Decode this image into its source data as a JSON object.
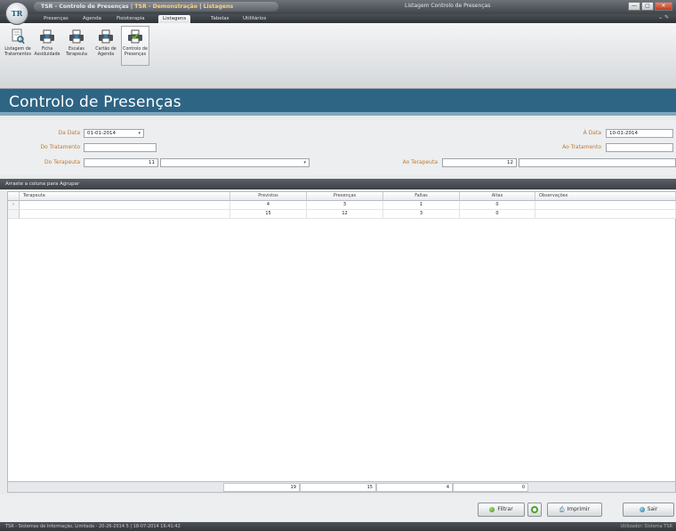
{
  "titlebar": {
    "path_app": "TSR - Controlo de Presenças",
    "sep1": " | ",
    "path_db": "TSR - Demonstração",
    "sep2": " | ",
    "path_view": "Listagens",
    "window_title": "Listagem Controlo de Presenças",
    "app_icon": "TR",
    "min_glyph": "—",
    "max_glyph": "▢",
    "close_glyph": "✕"
  },
  "menu": {
    "tabs": [
      "Presenças",
      "Agenda",
      "Fisioterapia",
      "Listagens",
      "Tabelas",
      "Utilitários"
    ],
    "active_index": 3,
    "right_glyphs": "⌄  ✎"
  },
  "ribbon": {
    "buttons": [
      {
        "label": "Listagem de Tratamentos",
        "icon": "document-search-icon"
      },
      {
        "label": "Ficha Assiduidade",
        "icon": "printer-icon"
      },
      {
        "label": "Escalas Terapeuta",
        "icon": "printer-icon"
      },
      {
        "label": "Cartão de Agenda",
        "icon": "printer-icon"
      },
      {
        "label": "Controlo de Presenças",
        "icon": "printer-check-icon"
      }
    ]
  },
  "page": {
    "title": "Controlo de Presenças"
  },
  "filters": {
    "da_data_label": "Da Data",
    "da_data_value": "01-01-2014",
    "a_data_label": "À Data",
    "a_data_value": "10-01-2014",
    "do_tratamento_label": "Do Tratamento",
    "do_tratamento_value": "",
    "ao_tratamento_label": "Ao Tratamento",
    "ao_tratamento_value": "",
    "do_terapeuta_label": "Do Terapeuta",
    "do_terapeuta_code": "11",
    "do_terapeuta_name": "",
    "ao_terapeuta_label": "Ao Terapeuta",
    "ao_terapeuta_code": "12",
    "ao_terapeuta_name": "",
    "dropdown_glyph": "▾"
  },
  "grid": {
    "group_hint": "Arraste a coluna para Agrupar",
    "columns": [
      "Terapeuta",
      "Previstos",
      "Presenças",
      "Faltas",
      "Altas",
      "Observações"
    ],
    "rows": [
      {
        "indicator": "›",
        "terapeuta": "",
        "previstos": "4",
        "presencas": "3",
        "faltas": "1",
        "altas": "0",
        "observacoes": ""
      },
      {
        "indicator": "",
        "terapeuta": "",
        "previstos": "15",
        "presencas": "12",
        "faltas": "3",
        "altas": "0",
        "observacoes": ""
      }
    ],
    "totals": {
      "previstos": "19",
      "presencas": "15",
      "faltas": "4",
      "altas": "0"
    }
  },
  "buttons": {
    "filtrar": "Filtrar",
    "imprimir": "Imprimir",
    "sair": "Sair"
  },
  "statusbar": {
    "left": "TSR - Sistemas de Informação, Limitada - 20-26-2014 5 | 18-07-2014 16:41:42",
    "right": "Utilizador: Sistema TSR"
  },
  "colors": {
    "banner": "#2f6584",
    "label": "#c07a2e",
    "accent_green": "#3d8a1e"
  }
}
